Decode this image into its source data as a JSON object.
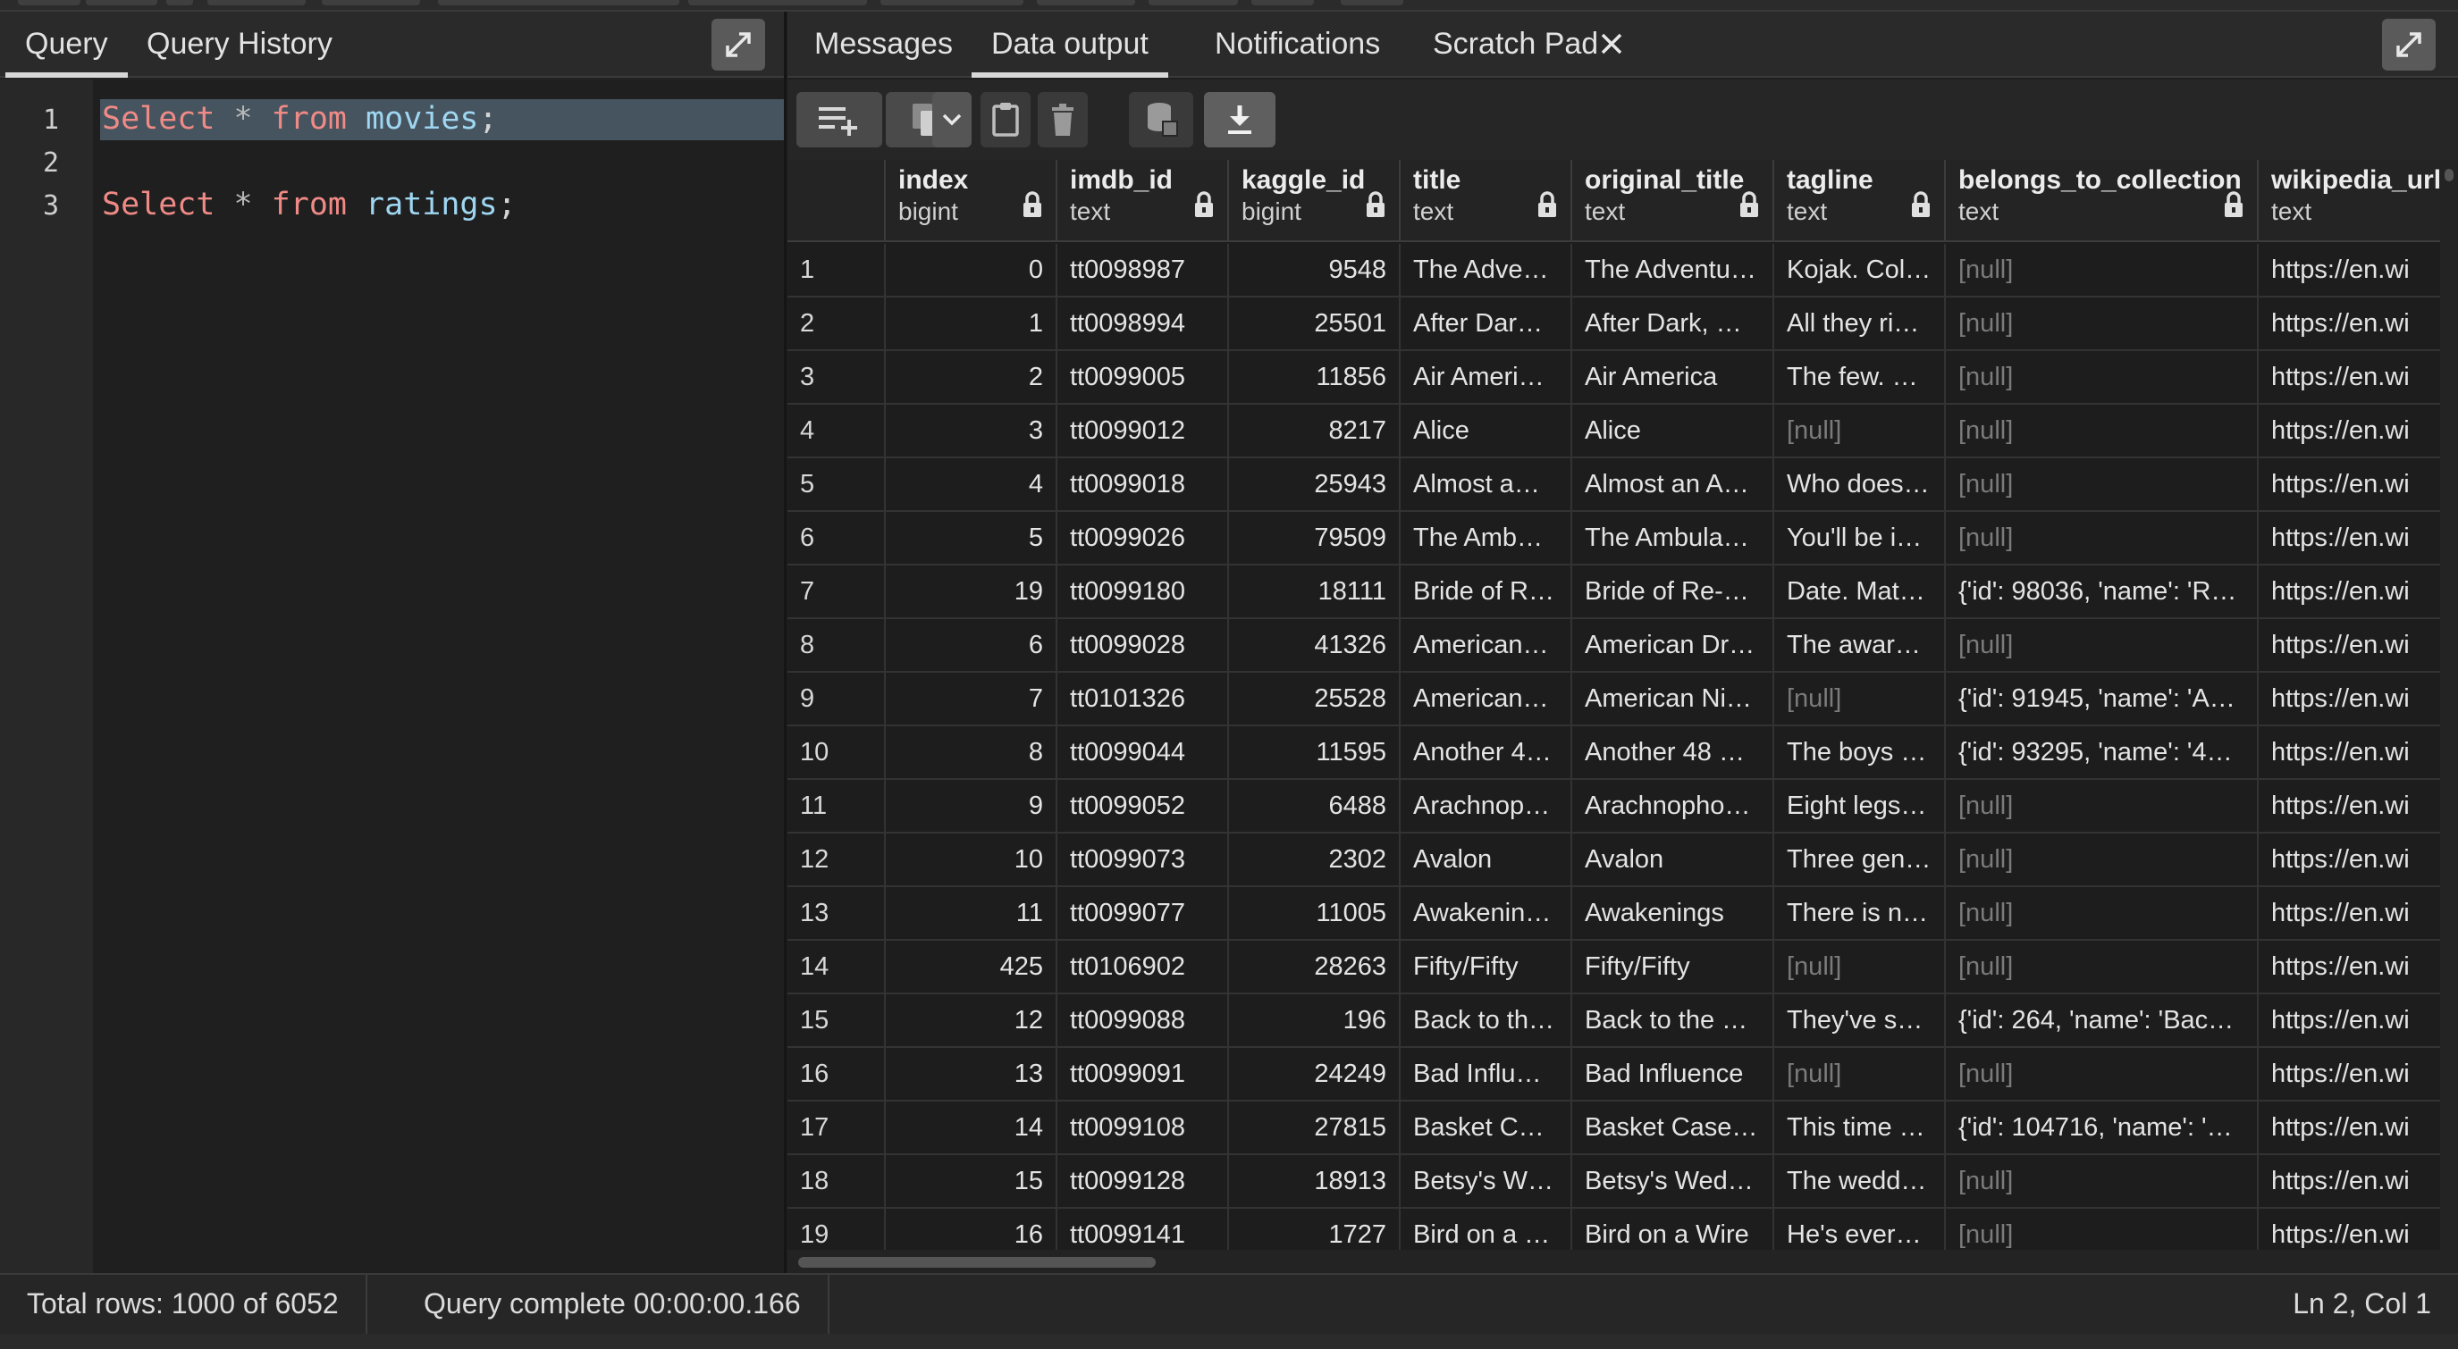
{
  "left_panel": {
    "tabs": [
      {
        "label": "Query",
        "active": true
      },
      {
        "label": "Query History",
        "active": false
      }
    ],
    "editor": {
      "current_line": 1,
      "lines": [
        {
          "number": "1",
          "keyword1": "Select",
          "operator": "*",
          "keyword2": "from",
          "table": "movies",
          "end": ";"
        },
        {
          "number": "2"
        },
        {
          "number": "3",
          "keyword1": "Select",
          "operator": "*",
          "keyword2": "from",
          "table": "ratings",
          "end": ";"
        }
      ]
    }
  },
  "right_panel": {
    "tabs": [
      {
        "label": "Messages",
        "active": false
      },
      {
        "label": "Data output",
        "active": true
      },
      {
        "label": "Notifications",
        "active": false
      },
      {
        "label": "Scratch Pad",
        "active": false,
        "closable": true
      }
    ],
    "toolbar_icons": [
      "add-row-icon",
      "copy-icon",
      "chevron-down-icon",
      "paste-icon",
      "delete-icon",
      "save-data-icon",
      "download-icon"
    ],
    "columns": [
      {
        "name": "index",
        "type": "bigint"
      },
      {
        "name": "imdb_id",
        "type": "text"
      },
      {
        "name": "kaggle_id",
        "type": "bigint"
      },
      {
        "name": "title",
        "type": "text"
      },
      {
        "name": "original_title",
        "type": "text"
      },
      {
        "name": "tagline",
        "type": "text"
      },
      {
        "name": "belongs_to_collection",
        "type": "text"
      },
      {
        "name": "wikipedia_url",
        "type": "text"
      }
    ],
    "rows": [
      [
        "1",
        "0",
        "tt0098987",
        "9548",
        "The Adve…",
        "The Adventu…",
        "Kojak. Col…",
        "[null]",
        "https://en.wi"
      ],
      [
        "2",
        "1",
        "tt0098994",
        "25501",
        "After Dar…",
        "After Dark, …",
        "All they ri…",
        "[null]",
        "https://en.wi"
      ],
      [
        "3",
        "2",
        "tt0099005",
        "11856",
        "Air Ameri…",
        "Air America",
        "The few. …",
        "[null]",
        "https://en.wi"
      ],
      [
        "4",
        "3",
        "tt0099012",
        "8217",
        "Alice",
        "Alice",
        "[null]",
        "[null]",
        "https://en.wi"
      ],
      [
        "5",
        "4",
        "tt0099018",
        "25943",
        "Almost a…",
        "Almost an A…",
        "Who does…",
        "[null]",
        "https://en.wi"
      ],
      [
        "6",
        "5",
        "tt0099026",
        "79509",
        "The Amb…",
        "The Ambula…",
        "You'll be i…",
        "[null]",
        "https://en.wi"
      ],
      [
        "7",
        "19",
        "tt0099180",
        "18111",
        "Bride of R…",
        "Bride of Re-…",
        "Date. Mat…",
        "{'id': 98036, 'name': 'R…",
        "https://en.wi"
      ],
      [
        "8",
        "6",
        "tt0099028",
        "41326",
        "American…",
        "American Dr…",
        "The awar…",
        "[null]",
        "https://en.wi"
      ],
      [
        "9",
        "7",
        "tt0101326",
        "25528",
        "American…",
        "American Ni…",
        "[null]",
        "{'id': 91945, 'name': 'A…",
        "https://en.wi"
      ],
      [
        "10",
        "8",
        "tt0099044",
        "11595",
        "Another 4…",
        "Another 48 …",
        "The boys …",
        "{'id': 93295, 'name': '4…",
        "https://en.wi"
      ],
      [
        "11",
        "9",
        "tt0099052",
        "6488",
        "Arachnop…",
        "Arachnopho…",
        "Eight legs…",
        "[null]",
        "https://en.wi"
      ],
      [
        "12",
        "10",
        "tt0099073",
        "2302",
        "Avalon",
        "Avalon",
        "Three gen…",
        "[null]",
        "https://en.wi"
      ],
      [
        "13",
        "11",
        "tt0099077",
        "11005",
        "Awakenin…",
        "Awakenings",
        "There is n…",
        "[null]",
        "https://en.wi"
      ],
      [
        "14",
        "425",
        "tt0106902",
        "28263",
        "Fifty/Fifty",
        "Fifty/Fifty",
        "[null]",
        "[null]",
        "https://en.wi"
      ],
      [
        "15",
        "12",
        "tt0099088",
        "196",
        "Back to th…",
        "Back to the …",
        "They've s…",
        "{'id': 264, 'name': 'Bac…",
        "https://en.wi"
      ],
      [
        "16",
        "13",
        "tt0099091",
        "24249",
        "Bad Influ…",
        "Bad Influence",
        "[null]",
        "[null]",
        "https://en.wi"
      ],
      [
        "17",
        "14",
        "tt0099108",
        "27815",
        "Basket C…",
        "Basket Case…",
        "This time …",
        "{'id': 104716, 'name': '…",
        "https://en.wi"
      ],
      [
        "18",
        "15",
        "tt0099128",
        "18913",
        "Betsy's W…",
        "Betsy's Wed…",
        "The wedd…",
        "[null]",
        "https://en.wi"
      ],
      [
        "19",
        "16",
        "tt0099141",
        "1727",
        "Bird on a …",
        "Bird on a Wire",
        "He's ever…",
        "[null]",
        "https://en.wi"
      ]
    ]
  },
  "status_bar": {
    "total_rows": "Total rows: 1000 of 6052",
    "query_status": "Query complete 00:00:00.166",
    "cursor": "Ln 2, Col 1"
  },
  "colors": {
    "background": "#1e1e1e",
    "keyword": "#f08a86",
    "identifier": "#9fd7f2",
    "null_text": "#7b7b7b",
    "selection": "#46545f"
  }
}
